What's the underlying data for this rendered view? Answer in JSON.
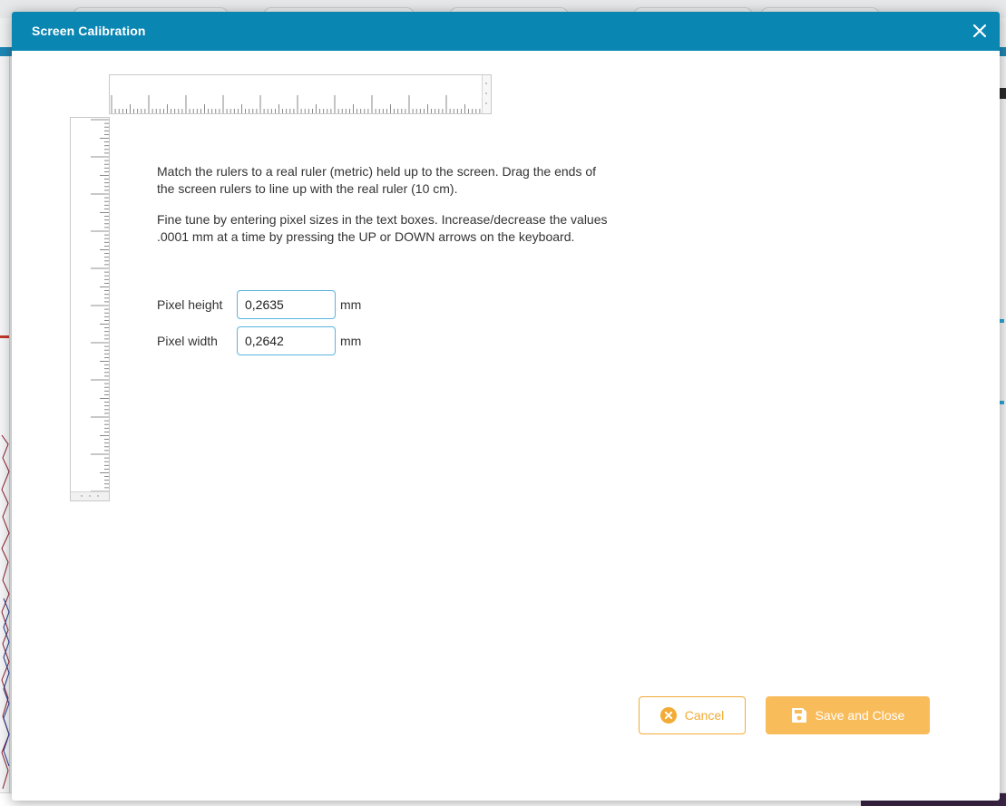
{
  "modal": {
    "title": "Screen Calibration",
    "close_icon": "close-icon"
  },
  "instructions": {
    "paragraph1": "Match the rulers to a real ruler (metric) held up to the screen. Drag the ends of the screen rulers to line up with the real ruler (10 cm).",
    "paragraph2": "Fine tune by entering pixel sizes in the text boxes. Increase/decrease the values .0001 mm at a time by pressing the UP or DOWN arrows on the keyboard."
  },
  "fields": {
    "pixel_height": {
      "label": "Pixel height",
      "value": "0,2635",
      "unit": "mm"
    },
    "pixel_width": {
      "label": "Pixel width",
      "value": "0,2642",
      "unit": "mm"
    }
  },
  "buttons": {
    "cancel": {
      "label": "Cancel",
      "icon": "cancel-circle-icon"
    },
    "save": {
      "label": "Save and Close",
      "icon": "save-icon"
    }
  },
  "colors": {
    "header": "#0a86b3",
    "accent_orange": "#f4ab36",
    "save_bg": "#f8bc5b",
    "input_border": "#5bb5dd"
  }
}
